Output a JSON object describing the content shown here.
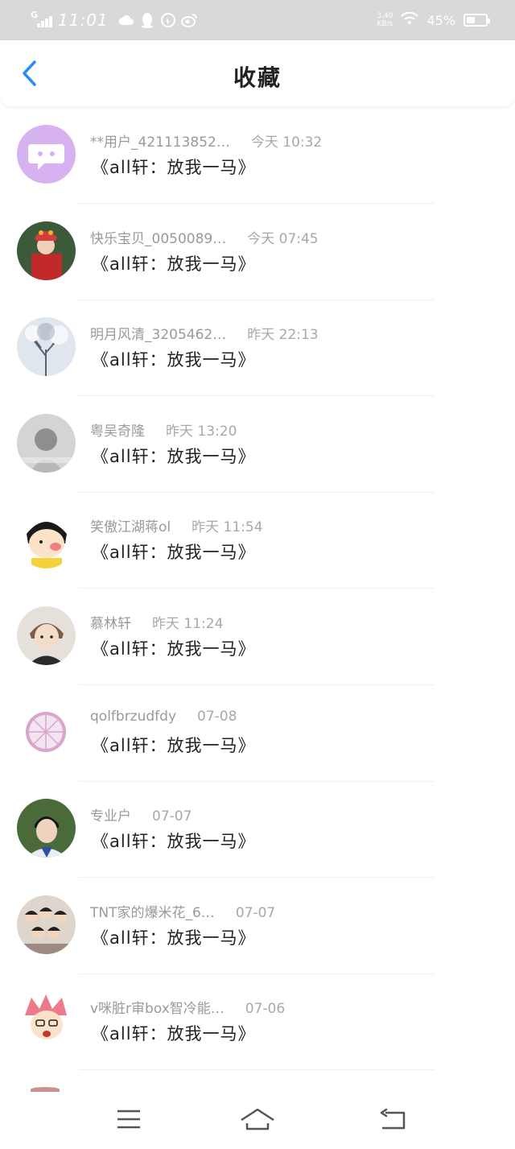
{
  "status_bar": {
    "network": "G",
    "time": "11:01",
    "speed_value": "3.40",
    "speed_unit": "KB/s",
    "battery_percent": "45%",
    "battery_level": 0.45
  },
  "header": {
    "title": "收藏"
  },
  "items": [
    {
      "username": "**用户_421113852…",
      "time": "今天 10:32",
      "title": "《all轩：放我一马》",
      "avatar_icon": "chat-bubble-avatar",
      "avatar_color": "#d6b3f0"
    },
    {
      "username": "快乐宝贝_0050089…",
      "time": "今天 07:45",
      "title": "《all轩：放我一马》",
      "avatar_icon": "opera-costume-avatar",
      "avatar_color": "#c0282a"
    },
    {
      "username": "明月风清_3205462…",
      "time": "昨天 22:13",
      "title": "《all轩：放我一马》",
      "avatar_icon": "snowy-tree-avatar",
      "avatar_color": "#98a6b4"
    },
    {
      "username": "粤吴奇隆",
      "time": "昨天 13:20",
      "title": "《all轩：放我一马》",
      "avatar_icon": "grayscale-photo-avatar",
      "avatar_color": "#b8b8b8"
    },
    {
      "username": "笑傲江湖蒋ol",
      "time": "昨天 11:54",
      "title": "《all轩：放我一马》",
      "avatar_icon": "cartoon-girl-avatar",
      "avatar_color": "#f6d23a"
    },
    {
      "username": "慕林轩",
      "time": "昨天 11:24",
      "title": "《all轩：放我一马》",
      "avatar_icon": "anime-boy-avatar",
      "avatar_color": "#7a5c48"
    },
    {
      "username": "qolfbrzudfdy",
      "time": "07-08",
      "title": "《all轩：放我一马》",
      "avatar_icon": "citrus-slice-avatar",
      "avatar_color": "#d8a6cc"
    },
    {
      "username": "专业户",
      "time": "07-07",
      "title": "《all轩：放我一马》",
      "avatar_icon": "boy-portrait-avatar",
      "avatar_color": "#4a6a3a"
    },
    {
      "username": "TNT家的爆米花_6…",
      "time": "07-07",
      "title": "《all轩：放我一马》",
      "avatar_icon": "group-photo-avatar",
      "avatar_color": "#9a8a80"
    },
    {
      "username": "v咪脏r审box智冷能…",
      "time": "07-06",
      "title": "《all轩：放我一马》",
      "avatar_icon": "anime-pink-hair-avatar",
      "avatar_color": "#ec7a8a"
    }
  ],
  "nav_bar": {
    "menu_icon": "menu-icon",
    "home_icon": "home-icon",
    "back_icon": "back-icon"
  },
  "colors": {
    "accent": "#2d8cf0",
    "status_bar_bg": "#d9d9d9",
    "meta_text": "#9a9a9a",
    "title_text": "#222222"
  }
}
